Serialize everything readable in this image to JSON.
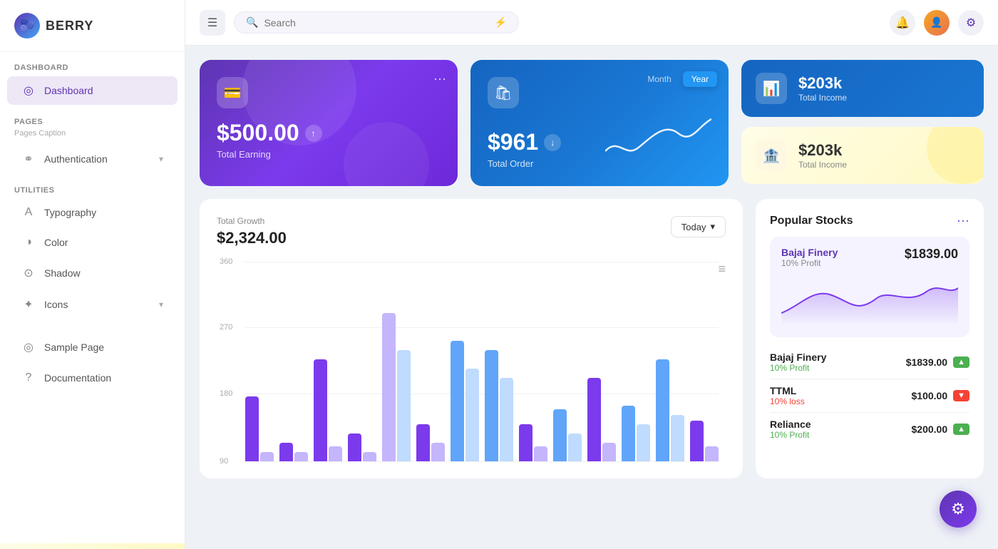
{
  "app": {
    "name": "BERRY",
    "logo_emoji": "🫐"
  },
  "topbar": {
    "search_placeholder": "Search",
    "menu_icon": "☰",
    "bell_icon": "🔔",
    "gear_icon": "⚙",
    "avatar_text": "U"
  },
  "sidebar": {
    "dashboard_section": "Dashboard",
    "dashboard_item": "Dashboard",
    "pages_section": "Pages",
    "pages_caption": "Pages Caption",
    "authentication_item": "Authentication",
    "utilities_section": "Utilities",
    "typography_item": "Typography",
    "color_item": "Color",
    "shadow_item": "Shadow",
    "icons_item": "Icons",
    "sample_page_item": "Sample Page",
    "documentation_item": "Documentation"
  },
  "cards": {
    "earning": {
      "amount": "$500.00",
      "label": "Total Earning",
      "trend_icon": "↑"
    },
    "order": {
      "amount": "$961",
      "label": "Total Order",
      "trend_icon": "↓",
      "tab_month": "Month",
      "tab_year": "Year"
    },
    "total_income_blue": {
      "amount": "$203k",
      "label": "Total Income"
    },
    "total_income_yellow": {
      "amount": "$203k",
      "label": "Total Income"
    }
  },
  "chart": {
    "title": "Total Growth",
    "amount": "$2,324.00",
    "today_label": "Today",
    "menu_icon": "≡",
    "y_labels": [
      "360",
      "270",
      "180",
      "90"
    ],
    "bars": [
      {
        "purple": 35,
        "lpurple": 5,
        "blue": 0,
        "lblue": 0
      },
      {
        "purple": 10,
        "lpurple": 5,
        "blue": 0,
        "lblue": 0
      },
      {
        "purple": 55,
        "lpurple": 8,
        "blue": 0,
        "lblue": 0
      },
      {
        "purple": 15,
        "lpurple": 5,
        "blue": 0,
        "lblue": 0
      },
      {
        "purple": 80,
        "lpurple": 60,
        "blue": 0,
        "lblue": 0
      },
      {
        "purple": 20,
        "lpurple": 10,
        "blue": 0,
        "lblue": 0
      },
      {
        "purple": 0,
        "lpurple": 0,
        "blue": 65,
        "lblue": 50
      },
      {
        "purple": 0,
        "lpurple": 0,
        "blue": 60,
        "lblue": 45
      },
      {
        "purple": 20,
        "lpurple": 8,
        "blue": 0,
        "lblue": 0
      },
      {
        "purple": 0,
        "lpurple": 0,
        "blue": 28,
        "lblue": 15
      },
      {
        "purple": 45,
        "lpurple": 10,
        "blue": 0,
        "lblue": 0
      },
      {
        "purple": 0,
        "lpurple": 0,
        "blue": 30,
        "lblue": 20
      },
      {
        "purple": 0,
        "lpurple": 0,
        "blue": 55,
        "lblue": 25
      },
      {
        "purple": 22,
        "lpurple": 8,
        "blue": 0,
        "lblue": 0
      }
    ]
  },
  "stocks": {
    "title": "Popular Stocks",
    "more_icon": "···",
    "chart_stock": {
      "name": "Bajaj Finery",
      "profit_label": "10% Profit",
      "price": "$1839.00"
    },
    "list": [
      {
        "name": "Bajaj Finery",
        "change": "10% Profit",
        "price": "$1839.00",
        "up": true
      },
      {
        "name": "TTML",
        "change": "10% loss",
        "price": "$100.00",
        "up": false
      },
      {
        "name": "Reliance",
        "change": "10% Profit",
        "price": "$200.00",
        "up": true
      }
    ]
  }
}
